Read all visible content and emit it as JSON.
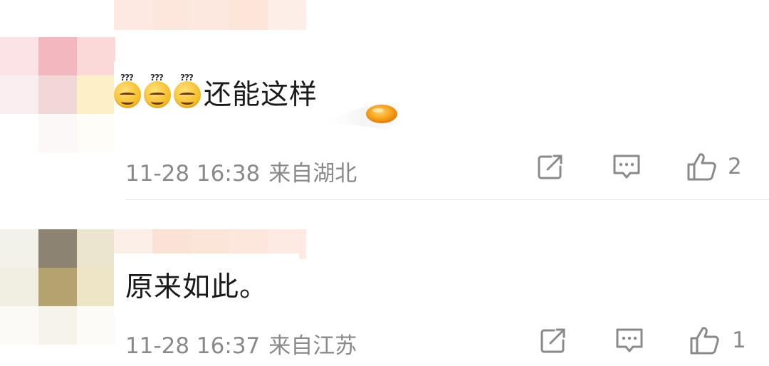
{
  "comments": [
    {
      "text": "还能这样",
      "emoji_count": 3,
      "emoji_icon": "dizzy-question-face-emoji",
      "timestamp": "11-28 16:38",
      "location": "来自湖北",
      "like_count": "2"
    },
    {
      "text": "原来如此。",
      "timestamp": "11-28 16:37",
      "location": "来自江苏",
      "like_count": "1"
    }
  ],
  "colors": {
    "meta_text": "#8a8a8a",
    "body_text": "#1a1a1a",
    "divider": "#e6e6e6"
  }
}
